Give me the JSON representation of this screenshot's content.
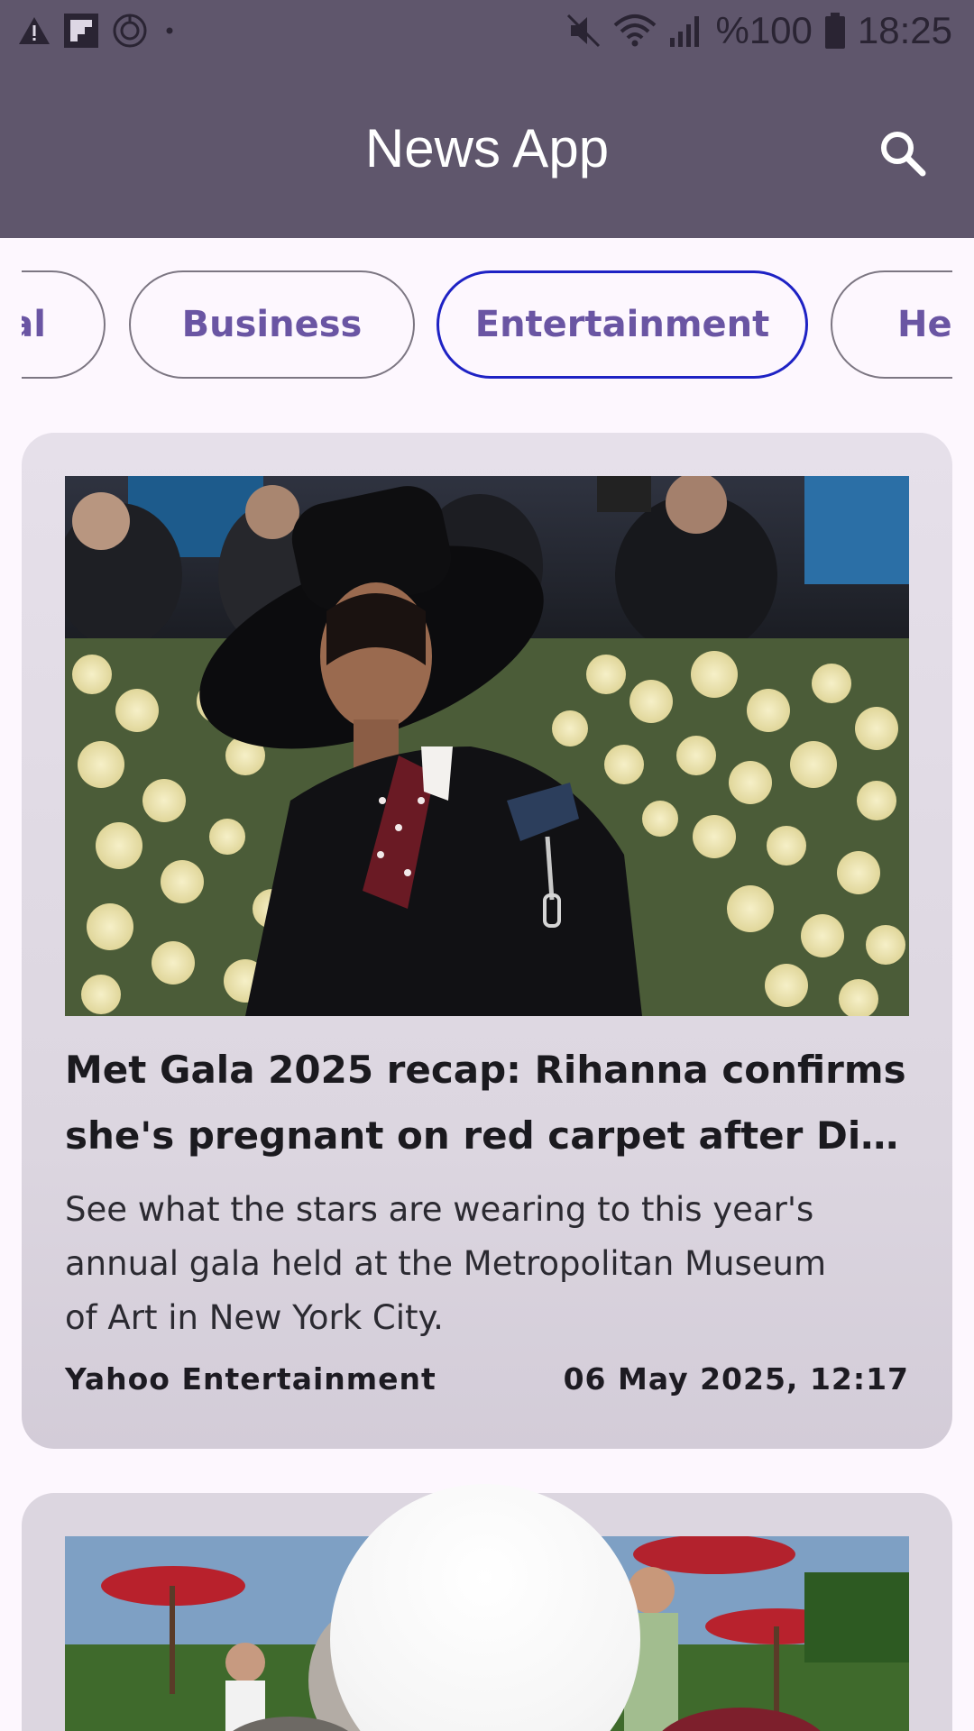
{
  "status_bar": {
    "battery_text": "%100",
    "time": "18:25",
    "icons": [
      "warning-icon",
      "flipboard-icon",
      "sync-icon",
      "dot-icon",
      "mute-icon",
      "wifi-icon",
      "signal-icon",
      "battery-icon"
    ]
  },
  "app_bar": {
    "title": "News App",
    "search_icon": "search-icon"
  },
  "categories": {
    "items": [
      {
        "label": "General",
        "visible_text": "al"
      },
      {
        "label": "Business"
      },
      {
        "label": "Entertainment",
        "selected": true
      },
      {
        "label": "Health",
        "visible_text": "Hea"
      }
    ],
    "selected_color": "#1e22c4",
    "chip_text_color": "#6a55a3"
  },
  "articles": [
    {
      "headline_line1": "Met Gala 2025 recap: Rihanna confirms",
      "headline_line2": "she's pregnant on red carpet after Diana…",
      "description_line1": "See what the stars are wearing to this year's",
      "description_line2": "annual gala held at the Metropolitan Museum",
      "description_line3": "of Art in New York City.",
      "source": "Yahoo Entertainment",
      "date": "06 May 2025, 12:17"
    },
    {
      "image": "garden-party-photo"
    }
  ],
  "colors": {
    "app_bar": "#5f566c",
    "background": "#fdf7fe",
    "card": "#e2dce6"
  }
}
